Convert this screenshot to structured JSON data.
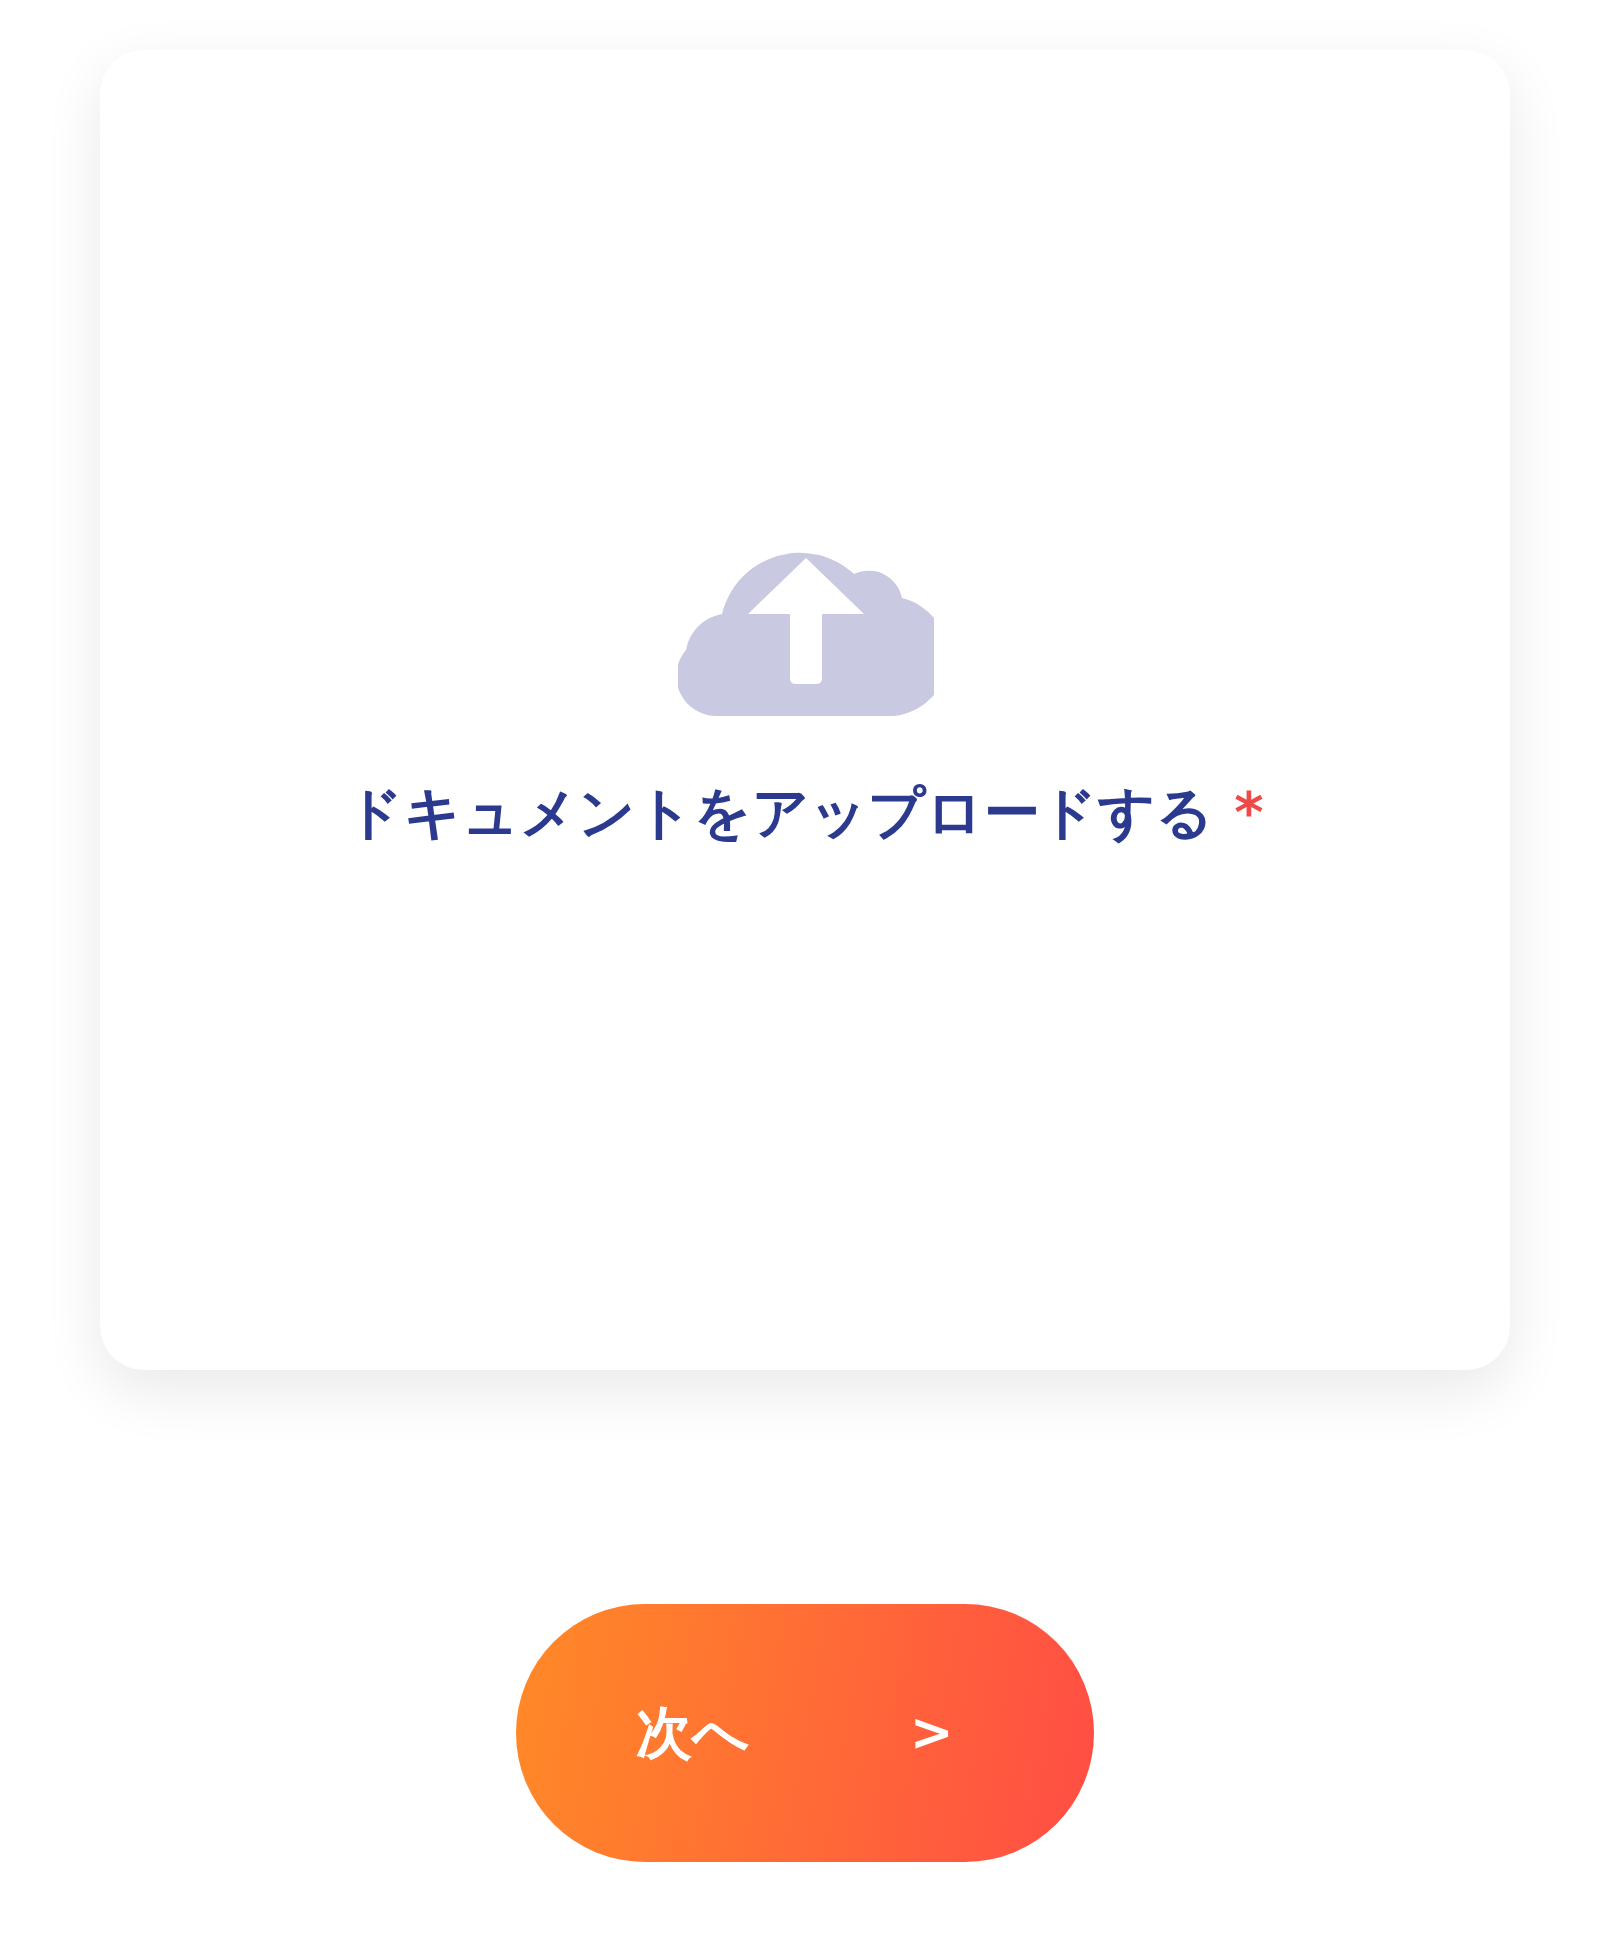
{
  "upload": {
    "label": "ドキュメントをアップロードする",
    "required_mark": "*"
  },
  "next_button": {
    "label": "次へ",
    "arrow": ">"
  }
}
